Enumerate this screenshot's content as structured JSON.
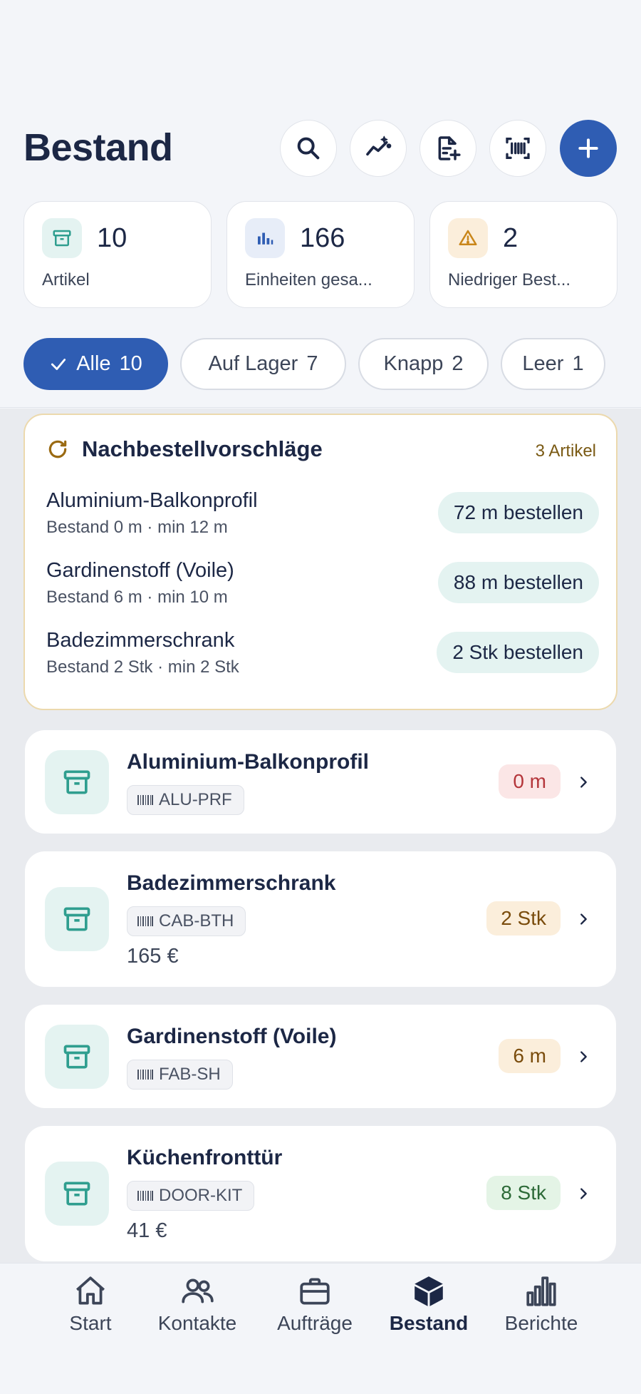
{
  "header": {
    "title": "Bestand",
    "actions": [
      {
        "name": "search-button",
        "icon": "search-icon"
      },
      {
        "name": "analytics-button",
        "icon": "sparkle-trend-icon"
      },
      {
        "name": "new-document-button",
        "icon": "file-plus-icon"
      },
      {
        "name": "barcode-scan-button",
        "icon": "barcode-scan-icon"
      },
      {
        "name": "add-button",
        "icon": "plus-icon"
      }
    ]
  },
  "stats": [
    {
      "value": "10",
      "label": "Artikel",
      "icon": "archive-icon",
      "color": "#2f9e8f"
    },
    {
      "value": "166",
      "label": "Einheiten gesa...",
      "icon": "bar-chart-icon",
      "color": "#2f5db3"
    },
    {
      "value": "2",
      "label": "Niedriger Best...",
      "icon": "warning-icon",
      "color": "#c9861a"
    }
  ],
  "filters": [
    {
      "label": "Alle",
      "count": "10",
      "active": true
    },
    {
      "label": "Auf Lager",
      "count": "7",
      "active": false
    },
    {
      "label": "Knapp",
      "count": "2",
      "active": false
    },
    {
      "label": "Leer",
      "count": "1",
      "active": false
    }
  ],
  "reorder": {
    "title": "Nachbestellvorschläge",
    "count_label": "3 Artikel",
    "rows": [
      {
        "name": "Aluminium-Balkonprofil",
        "detail": "Bestand 0 m · min 12 m",
        "action": "72 m bestellen"
      },
      {
        "name": "Gardinenstoff (Voile)",
        "detail": "Bestand 6 m · min 10 m",
        "action": "88 m bestellen"
      },
      {
        "name": "Badezimmerschrank",
        "detail": "Bestand 2 Stk · min 2 Stk",
        "action": "2 Stk bestellen"
      }
    ]
  },
  "items": [
    {
      "name": "Aluminium-Balkonprofil",
      "sku": "ALU-PRF",
      "price": "",
      "qty": "0 m",
      "status": "red"
    },
    {
      "name": "Badezimmerschrank",
      "sku": "CAB-BTH",
      "price": "165 €",
      "qty": "2 Stk",
      "status": "orange"
    },
    {
      "name": "Gardinenstoff (Voile)",
      "sku": "FAB-SH",
      "price": "",
      "qty": "6 m",
      "status": "orange"
    },
    {
      "name": "Küchenfronttür",
      "sku": "DOOR-KIT",
      "price": "41 €",
      "qty": "8 Stk",
      "status": "green"
    }
  ],
  "tabbar": [
    {
      "label": "Start",
      "icon": "home-icon",
      "active": false
    },
    {
      "label": "Kontakte",
      "icon": "users-icon",
      "active": false
    },
    {
      "label": "Aufträge",
      "icon": "briefcase-icon",
      "active": false
    },
    {
      "label": "Bestand",
      "icon": "box-icon",
      "active": true
    },
    {
      "label": "Berichte",
      "icon": "bar-chart-icon",
      "active": false
    }
  ],
  "colors": {
    "primary": "#2f5db3",
    "teal": "#2f9e8f",
    "warning": "#c9861a"
  }
}
